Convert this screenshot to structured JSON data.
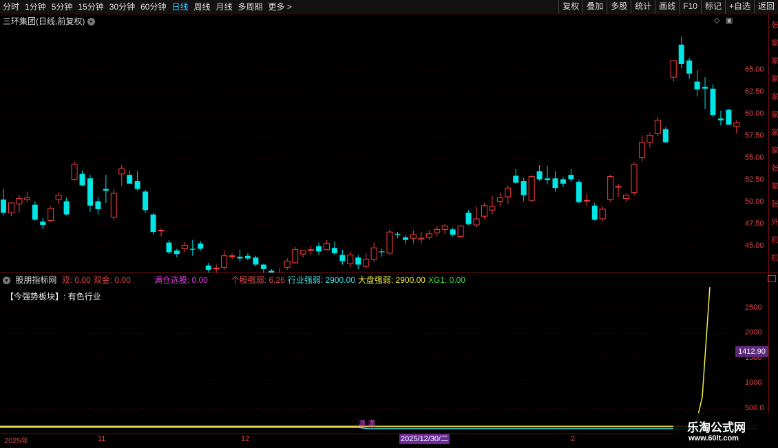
{
  "toolbar": {
    "periods": [
      "分时",
      "1分钟",
      "5分钟",
      "15分钟",
      "30分钟",
      "60分钟",
      "日线",
      "周线",
      "月线",
      "多周期",
      "更多 >"
    ],
    "active_period": "日线",
    "tools": [
      "复权",
      "叠加",
      "多股",
      "统计",
      "画线",
      "F10",
      "标记",
      "+自选",
      "返回"
    ]
  },
  "main_title": "三环集团(日线,前复权)",
  "price_axis": [
    "65.00",
    "62.50",
    "60.00",
    "57.50",
    "55.00",
    "52.50",
    "50.00",
    "47.50",
    "45.00"
  ],
  "right_edge_glyphs": [
    "张",
    "家",
    "家",
    "家",
    "家",
    "家",
    "家",
    "家",
    "张",
    "家",
    "张",
    "外",
    "机",
    "机"
  ],
  "indicator": {
    "name": "股朋指标网",
    "items": [
      {
        "label": "双: 0.00",
        "color": "#e04848"
      },
      {
        "label": "双金: 0.00",
        "color": "#e04848"
      },
      {
        "label": "满仓选股: 0.00",
        "color": "#e040e0"
      },
      {
        "label": "个股强弱: 6.26",
        "color": "#e04848"
      },
      {
        "label": "行业强弱: 2900.00",
        "color": "#40e0e0"
      },
      {
        "label": "大盘强弱: 2900.00",
        "color": "#f0f040"
      },
      {
        "label": "XG1: 0.00",
        "color": "#40e040"
      }
    ],
    "strong_sector_label": "【今强势板块】: 有色行业",
    "axis": [
      "2500",
      "2000",
      "1500",
      "1000",
      "500.0"
    ],
    "current_value": "1412.90",
    "marker_text": "满 满"
  },
  "dates": {
    "labels": [
      "2025年",
      "11",
      "12",
      "2"
    ],
    "selected": "2025/12/30/二"
  },
  "watermark": {
    "title": "乐淘公式网",
    "url": "www.60lt.com"
  },
  "colors": {
    "up": "#ff4040",
    "down": "#00e5e5",
    "grid": "#5a0000",
    "axis_text": "#e04848"
  },
  "chart_data": {
    "type": "candlestick",
    "ylim": [
      42.0,
      70.0
    ],
    "candles": [
      [
        50.3,
        51.5,
        48.5,
        48.8
      ],
      [
        48.8,
        49.9,
        48.4,
        49.9
      ],
      [
        49.8,
        50.8,
        48.8,
        50.4
      ],
      [
        50.3,
        51.2,
        50.0,
        50.5
      ],
      [
        49.7,
        50.1,
        47.9,
        48.0
      ],
      [
        47.8,
        48.2,
        46.9,
        47.4
      ],
      [
        47.9,
        49.5,
        47.8,
        49.3
      ],
      [
        50.3,
        51.1,
        49.8,
        50.8
      ],
      [
        50.1,
        50.5,
        48.5,
        48.6
      ],
      [
        52.6,
        54.6,
        52.4,
        54.3
      ],
      [
        53.2,
        53.6,
        51.8,
        51.9
      ],
      [
        52.7,
        53.1,
        48.9,
        49.6
      ],
      [
        50.1,
        50.6,
        48.6,
        49.2
      ],
      [
        51.5,
        53.1,
        49.9,
        51.3
      ],
      [
        48.3,
        51.5,
        47.9,
        51.0
      ],
      [
        53.2,
        54.2,
        51.8,
        53.8
      ],
      [
        53.1,
        53.6,
        52.1,
        52.1
      ],
      [
        52.4,
        53.5,
        51.3,
        51.5
      ],
      [
        51.2,
        51.4,
        48.8,
        49.1
      ],
      [
        48.6,
        48.8,
        46.3,
        46.6
      ],
      [
        46.8,
        47.0,
        46.1,
        46.8
      ],
      [
        45.4,
        45.7,
        44.1,
        44.3
      ],
      [
        44.5,
        44.7,
        43.7,
        44.1
      ],
      [
        44.7,
        45.5,
        44.3,
        45.1
      ],
      [
        44.7,
        45.7,
        43.9,
        44.6
      ],
      [
        45.3,
        45.6,
        44.5,
        44.7
      ],
      [
        42.8,
        43.1,
        42.0,
        42.3
      ],
      [
        42.5,
        42.9,
        41.5,
        42.5
      ],
      [
        42.6,
        44.5,
        42.3,
        43.9
      ],
      [
        43.9,
        44.2,
        43.5,
        43.9
      ],
      [
        43.8,
        44.6,
        43.2,
        43.6
      ],
      [
        43.9,
        44.2,
        43.4,
        43.6
      ],
      [
        43.7,
        43.9,
        42.7,
        42.9
      ],
      [
        42.9,
        43.0,
        41.9,
        42.4
      ],
      [
        42.2,
        42.4,
        41.7,
        41.8
      ],
      [
        41.9,
        42.5,
        41.2,
        41.9
      ],
      [
        42.6,
        43.6,
        42.3,
        43.3
      ],
      [
        43.1,
        44.9,
        43.0,
        44.6
      ],
      [
        44.1,
        44.5,
        43.7,
        44.5
      ],
      [
        44.6,
        45.0,
        44.0,
        44.6
      ],
      [
        45.0,
        45.4,
        44.0,
        44.4
      ],
      [
        44.6,
        45.7,
        44.5,
        45.3
      ],
      [
        44.8,
        45.5,
        44.0,
        44.2
      ],
      [
        44.0,
        44.6,
        42.9,
        43.3
      ],
      [
        43.0,
        44.4,
        42.6,
        44.0
      ],
      [
        43.7,
        44.0,
        42.4,
        42.9
      ],
      [
        42.7,
        44.2,
        42.5,
        43.5
      ],
      [
        43.5,
        45.4,
        43.2,
        44.8
      ],
      [
        44.4,
        44.7,
        43.8,
        44.3
      ],
      [
        44.2,
        46.9,
        44.0,
        46.6
      ],
      [
        46.4,
        46.6,
        45.9,
        46.3
      ],
      [
        46.0,
        46.3,
        45.2,
        45.7
      ],
      [
        45.9,
        46.8,
        45.3,
        46.3
      ],
      [
        45.8,
        46.6,
        45.3,
        45.9
      ],
      [
        46.0,
        46.8,
        45.7,
        46.4
      ],
      [
        46.5,
        47.3,
        46.1,
        46.9
      ],
      [
        46.9,
        47.5,
        46.4,
        47.3
      ],
      [
        46.9,
        47.1,
        46.1,
        46.3
      ],
      [
        46.1,
        47.4,
        46.0,
        47.3
      ],
      [
        48.8,
        49.1,
        47.4,
        47.5
      ],
      [
        47.4,
        49.5,
        47.1,
        48.1
      ],
      [
        48.4,
        49.9,
        48.1,
        49.6
      ],
      [
        49.1,
        50.7,
        48.6,
        49.5
      ],
      [
        50.1,
        51.1,
        49.5,
        50.5
      ],
      [
        50.6,
        51.9,
        49.8,
        51.6
      ],
      [
        53.0,
        53.8,
        52.1,
        52.2
      ],
      [
        52.4,
        52.8,
        50.1,
        50.8
      ],
      [
        50.2,
        53.1,
        50.0,
        52.9
      ],
      [
        53.5,
        54.2,
        52.4,
        52.6
      ],
      [
        52.7,
        54.1,
        52.0,
        52.5
      ],
      [
        52.7,
        53.5,
        51.2,
        51.6
      ],
      [
        52.6,
        52.9,
        51.7,
        52.1
      ],
      [
        53.1,
        53.8,
        52.3,
        52.6
      ],
      [
        52.3,
        52.5,
        49.9,
        50.0
      ],
      [
        50.2,
        51.0,
        49.5,
        50.2
      ],
      [
        49.6,
        49.9,
        47.9,
        48.0
      ],
      [
        48.1,
        49.5,
        47.8,
        49.2
      ],
      [
        50.3,
        53.1,
        50.1,
        52.9
      ],
      [
        51.7,
        52.1,
        50.6,
        51.8
      ],
      [
        50.4,
        51.0,
        50.1,
        50.8
      ],
      [
        51.1,
        54.5,
        50.8,
        54.3
      ],
      [
        55.1,
        57.5,
        54.6,
        56.8
      ],
      [
        56.8,
        57.9,
        56.2,
        57.6
      ],
      [
        57.8,
        59.7,
        57.5,
        59.3
      ],
      [
        58.3,
        58.5,
        56.7,
        56.8
      ],
      [
        64.2,
        65.4,
        63.7,
        66.1
      ],
      [
        67.9,
        68.8,
        65.2,
        65.7
      ],
      [
        66.1,
        66.4,
        64.0,
        64.6
      ],
      [
        63.7,
        65.0,
        62.0,
        62.8
      ],
      [
        63.1,
        64.2,
        60.6,
        62.9
      ],
      [
        62.9,
        63.4,
        59.7,
        59.9
      ],
      [
        59.5,
        60.4,
        58.7,
        59.3
      ],
      [
        60.5,
        60.6,
        58.8,
        58.8
      ],
      [
        58.6,
        59.3,
        57.8,
        59.0
      ]
    ]
  }
}
